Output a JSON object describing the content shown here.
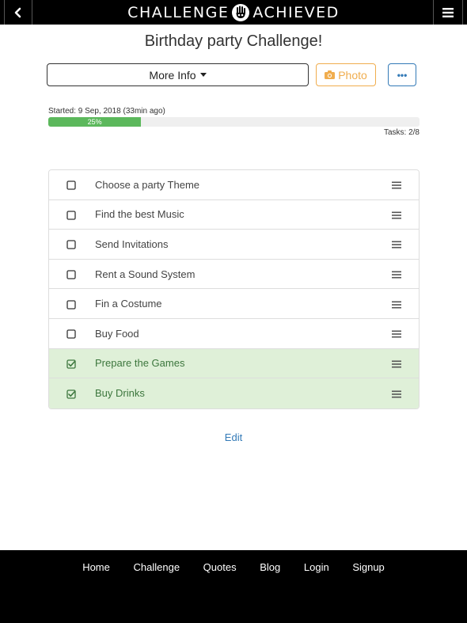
{
  "header": {
    "brand_left": "CHALLENGE",
    "brand_right": "ACHIEVED",
    "back_icon": "chevron-left-icon",
    "menu_icon": "hamburger-icon"
  },
  "page": {
    "title": "Birthday party Challenge!"
  },
  "actions": {
    "more_info_label": "More Info",
    "photo_label": "Photo",
    "dots_label": "•••"
  },
  "progress": {
    "started_text": "Started: 9 Sep, 2018 (33min ago)",
    "percent": 25,
    "percent_label": "25%",
    "tasks_text": "Tasks: 2/8"
  },
  "tasks": [
    {
      "label": "Choose a party Theme",
      "done": false
    },
    {
      "label": "Find the best Music",
      "done": false
    },
    {
      "label": "Send Invitations",
      "done": false
    },
    {
      "label": "Rent a Sound System",
      "done": false
    },
    {
      "label": "Fin a Costume",
      "done": false
    },
    {
      "label": "Buy Food",
      "done": false
    },
    {
      "label": "Prepare the Games",
      "done": true
    },
    {
      "label": "Buy Drinks",
      "done": true
    }
  ],
  "edit_label": "Edit",
  "footer": {
    "links": [
      "Home",
      "Challenge",
      "Quotes",
      "Blog",
      "Login",
      "Signup"
    ]
  },
  "colors": {
    "accent_blue": "#337ab7",
    "warning_orange": "#f0ad4e",
    "success_green": "#5cb85c",
    "done_row_bg": "#dff0d8",
    "done_text": "#3c763d"
  }
}
